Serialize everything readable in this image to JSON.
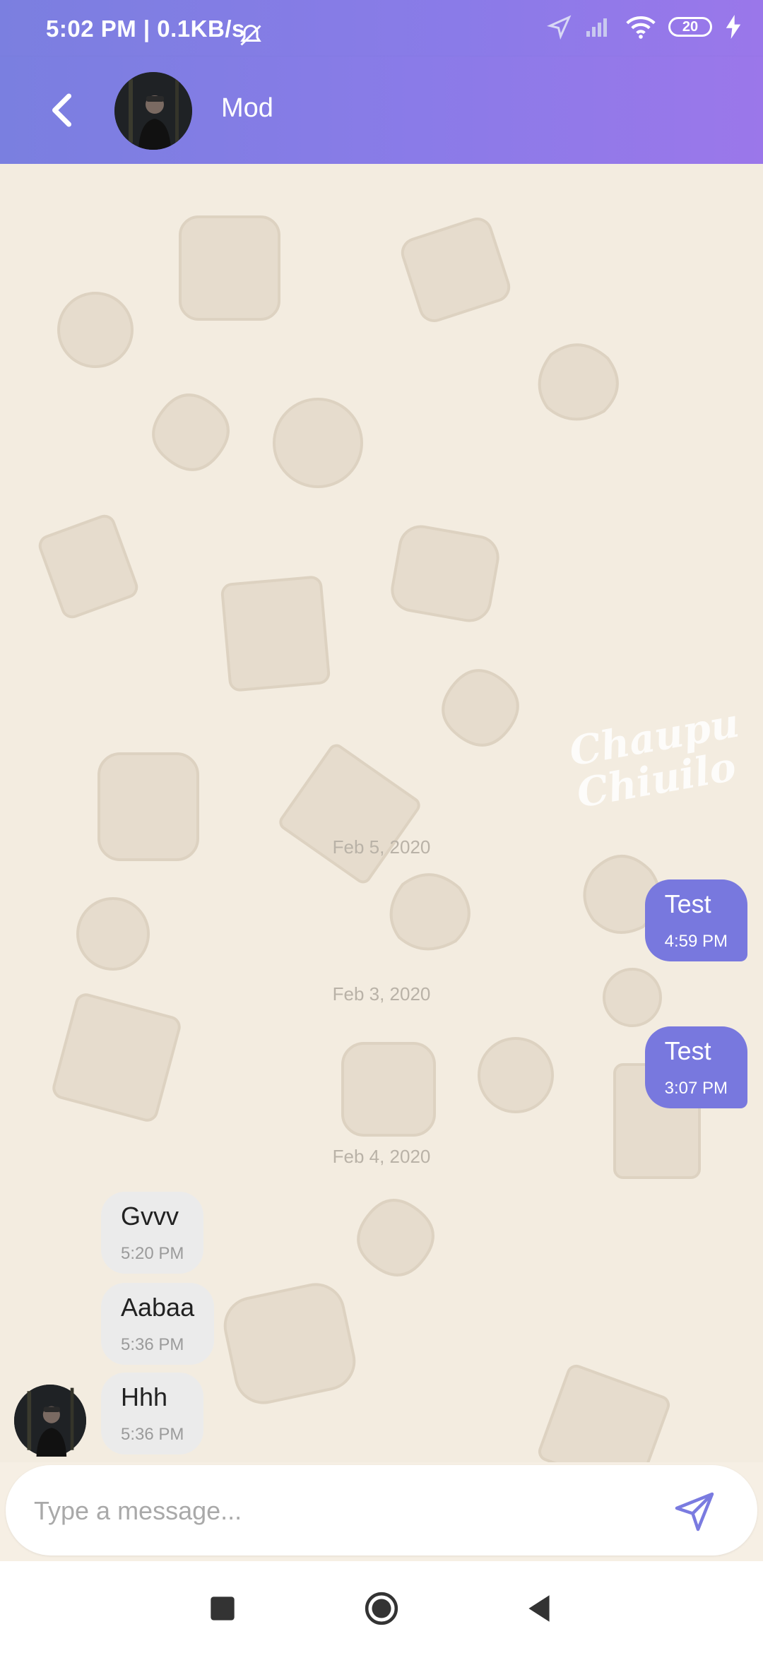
{
  "status_bar": {
    "time": "5:02 PM | 0.1KB/s",
    "battery": "20",
    "icons": [
      "mute-bell-icon",
      "location-arrow-icon",
      "signal-icon",
      "wifi-icon",
      "battery-icon",
      "charging-icon"
    ]
  },
  "header": {
    "title": "Mod",
    "back_icon": "back-chevron-icon"
  },
  "chat": {
    "background_watermark": "Chaupu Chiuilo",
    "messages": [
      {
        "type": "date",
        "text": "Feb 5, 2020"
      },
      {
        "type": "outgoing",
        "text": "Test",
        "time": "4:59 PM"
      },
      {
        "type": "date",
        "text": "Feb 3, 2020"
      },
      {
        "type": "outgoing",
        "text": "Test",
        "time": "3:07 PM"
      },
      {
        "type": "date",
        "text": "Feb 4, 2020"
      },
      {
        "type": "incoming",
        "text": "Gvvv",
        "time": "5:20 PM"
      },
      {
        "type": "incoming",
        "text": "Aabaa",
        "time": "5:36 PM"
      },
      {
        "type": "incoming",
        "text": "Hhh",
        "time": "5:36 PM"
      }
    ]
  },
  "composer": {
    "placeholder": "Type a message...",
    "value": "",
    "send_icon": "send-icon"
  },
  "navigation": [
    "recents-square-icon",
    "home-circle-icon",
    "back-triangle-icon"
  ],
  "colors": {
    "header_gradient_start": "#7a7fe0",
    "header_gradient_end": "#9b77ea",
    "outgoing_bubble": "#7878de",
    "incoming_bubble": "#ebebeb",
    "chat_background": "#f3ece0"
  }
}
